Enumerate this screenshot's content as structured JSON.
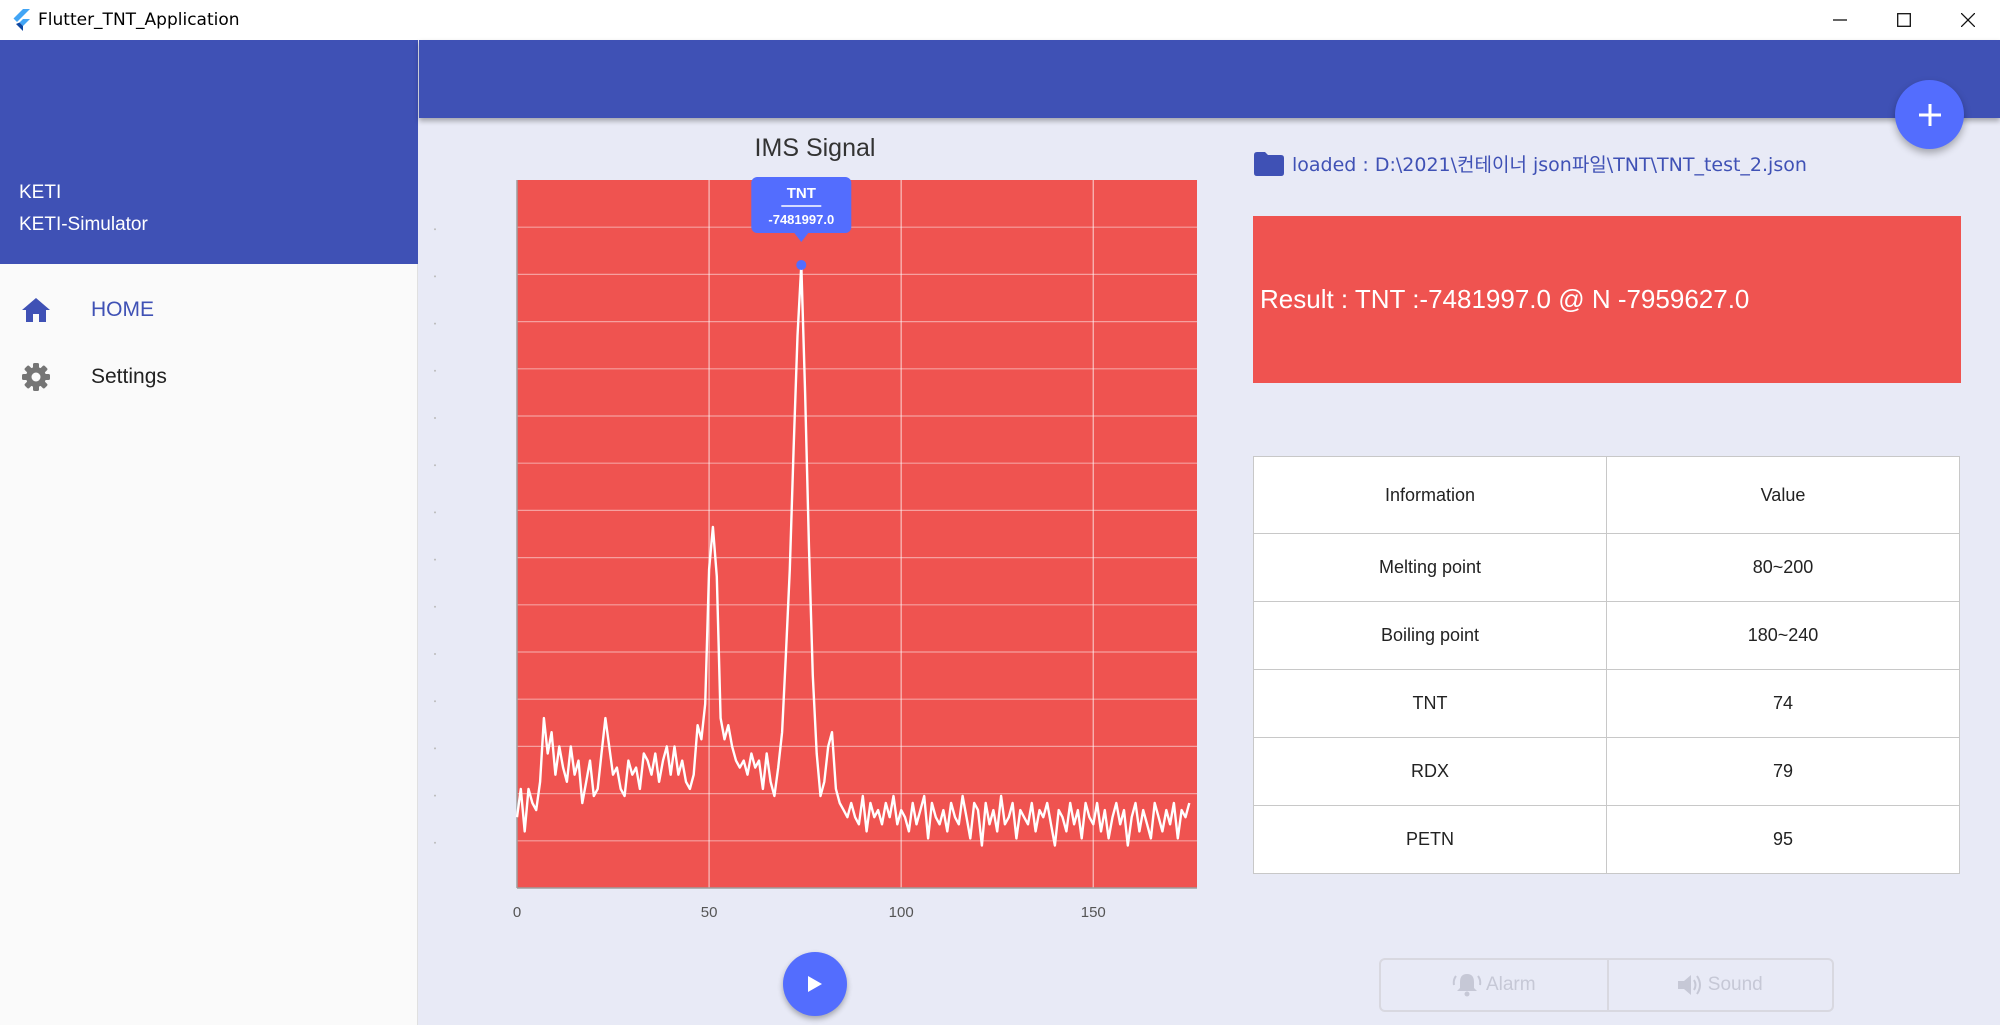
{
  "window": {
    "title": "Flutter_TNT_Application"
  },
  "sidebar": {
    "header_line1": "KETI",
    "header_line2": "KETI-Simulator",
    "items": [
      {
        "label": "HOME",
        "icon": "home-icon",
        "active": true
      },
      {
        "label": "Settings",
        "icon": "gear-icon",
        "active": false
      }
    ]
  },
  "chart_data": {
    "type": "line",
    "title": "IMS Signal",
    "xlim": [
      0,
      177
    ],
    "x_ticks": [
      0,
      50,
      100,
      150
    ],
    "grid": true,
    "background_color": "#ef5350",
    "line_color": "#ffffff",
    "series": [
      {
        "values": [
          0.1,
          0.14,
          0.08,
          0.14,
          0.12,
          0.11,
          0.15,
          0.24,
          0.19,
          0.22,
          0.16,
          0.2,
          0.17,
          0.15,
          0.2,
          0.16,
          0.18,
          0.12,
          0.15,
          0.18,
          0.13,
          0.14,
          0.19,
          0.24,
          0.2,
          0.16,
          0.17,
          0.14,
          0.13,
          0.18,
          0.16,
          0.17,
          0.14,
          0.19,
          0.18,
          0.16,
          0.19,
          0.15,
          0.18,
          0.2,
          0.16,
          0.2,
          0.16,
          0.18,
          0.15,
          0.14,
          0.16,
          0.23,
          0.21,
          0.26,
          0.45,
          0.51,
          0.44,
          0.24,
          0.21,
          0.23,
          0.2,
          0.18,
          0.17,
          0.18,
          0.16,
          0.19,
          0.17,
          0.18,
          0.14,
          0.19,
          0.15,
          0.13,
          0.17,
          0.22,
          0.33,
          0.45,
          0.62,
          0.78,
          0.88,
          0.7,
          0.48,
          0.3,
          0.19,
          0.13,
          0.15,
          0.2,
          0.22,
          0.14,
          0.12,
          0.11,
          0.1,
          0.12,
          0.1,
          0.09,
          0.13,
          0.08,
          0.12,
          0.1,
          0.11,
          0.09,
          0.12,
          0.1,
          0.13,
          0.09,
          0.11,
          0.1,
          0.08,
          0.12,
          0.09,
          0.11,
          0.13,
          0.07,
          0.12,
          0.1,
          0.09,
          0.11,
          0.08,
          0.12,
          0.1,
          0.09,
          0.13,
          0.1,
          0.07,
          0.12,
          0.11,
          0.06,
          0.12,
          0.09,
          0.11,
          0.08,
          0.13,
          0.09,
          0.1,
          0.12,
          0.07,
          0.11,
          0.1,
          0.09,
          0.12,
          0.08,
          0.11,
          0.1,
          0.12,
          0.09,
          0.06,
          0.11,
          0.1,
          0.08,
          0.12,
          0.09,
          0.11,
          0.07,
          0.12,
          0.1,
          0.09,
          0.12,
          0.08,
          0.11,
          0.07,
          0.1,
          0.12,
          0.09,
          0.11,
          0.06,
          0.1,
          0.12,
          0.08,
          0.11,
          0.09,
          0.07,
          0.12,
          0.1,
          0.08,
          0.11,
          0.09,
          0.12,
          0.07,
          0.11,
          0.1,
          0.12
        ]
      }
    ],
    "tooltip": {
      "title": "TNT",
      "value": "-7481997.0",
      "x": 74
    }
  },
  "main": {
    "loaded_text": "loaded : D:\\2021\\컨테이너 json파일\\TNT\\TNT_test_2.json",
    "result_text": "Result :  TNT :-7481997.0 @ N  -7959627.0",
    "result_color": "#ef5350",
    "table": {
      "headers": [
        "Information",
        "Value"
      ],
      "rows": [
        [
          "Melting point",
          "80~200"
        ],
        [
          "Boiling point",
          "180~240"
        ],
        [
          "TNT",
          "74"
        ],
        [
          "RDX",
          "79"
        ],
        [
          "PETN",
          "95"
        ]
      ]
    },
    "buttons": {
      "alarm": "Alarm",
      "sound": "Sound"
    }
  },
  "colors": {
    "primary": "#3f51b5",
    "accent": "#536dfe",
    "background": "#e8eaf6"
  }
}
